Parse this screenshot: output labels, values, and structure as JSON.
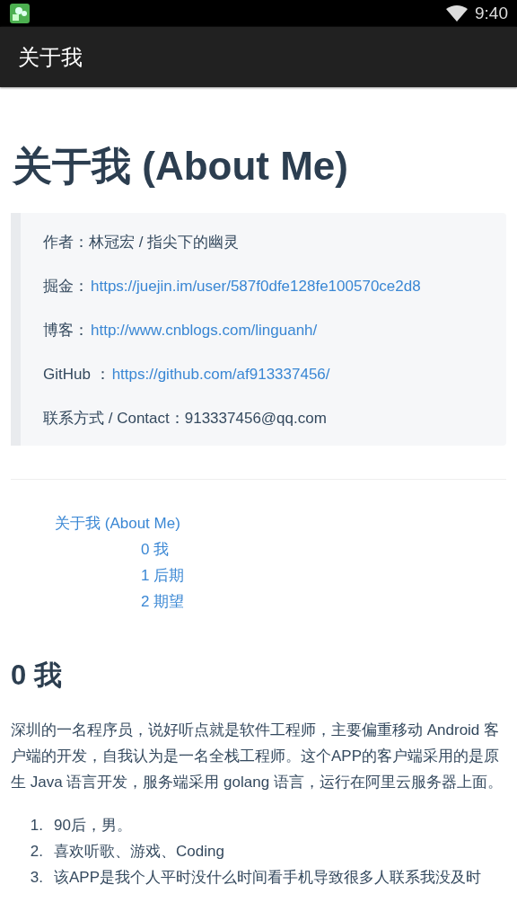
{
  "status_bar": {
    "time": "9:40"
  },
  "app_bar": {
    "title": "关于我"
  },
  "article": {
    "title": "关于我 (About Me)",
    "info_lines": [
      {
        "text": "作者：林冠宏 / 指尖下的幽灵"
      },
      {
        "label": "掘金：",
        "link": "https://juejin.im/user/587f0dfe128fe100570ce2d8"
      },
      {
        "label": "博客：",
        "link": "http://www.cnblogs.com/linguanh/"
      },
      {
        "label": "GitHub ：",
        "link": "https://github.com/af913337456/"
      },
      {
        "text": "联系方式 / Contact：913337456@qq.com"
      }
    ],
    "toc": [
      {
        "label": "关于我 (About Me)",
        "children": [
          {
            "label": "0 我"
          },
          {
            "label": "1 后期"
          },
          {
            "label": "2 期望"
          }
        ]
      }
    ],
    "section": {
      "heading": "0 我",
      "paragraph": "深圳的一名程序员，说好听点就是软件工程师，主要偏重移动 Android 客户端的开发，自我认为是一名全栈工程师。这个APP的客户端采用的是原生 Java 语言开发，服务端采用 golang 语言，运行在阿里云服务器上面。",
      "list": [
        {
          "number": "1.",
          "text": "90后，男。"
        },
        {
          "number": "2.",
          "text": "喜欢听歌、游戏、Coding"
        },
        {
          "number": "3.",
          "text": "该APP是我个人平时没什么时间看手机导致很多人联系我没及时"
        }
      ]
    }
  }
}
